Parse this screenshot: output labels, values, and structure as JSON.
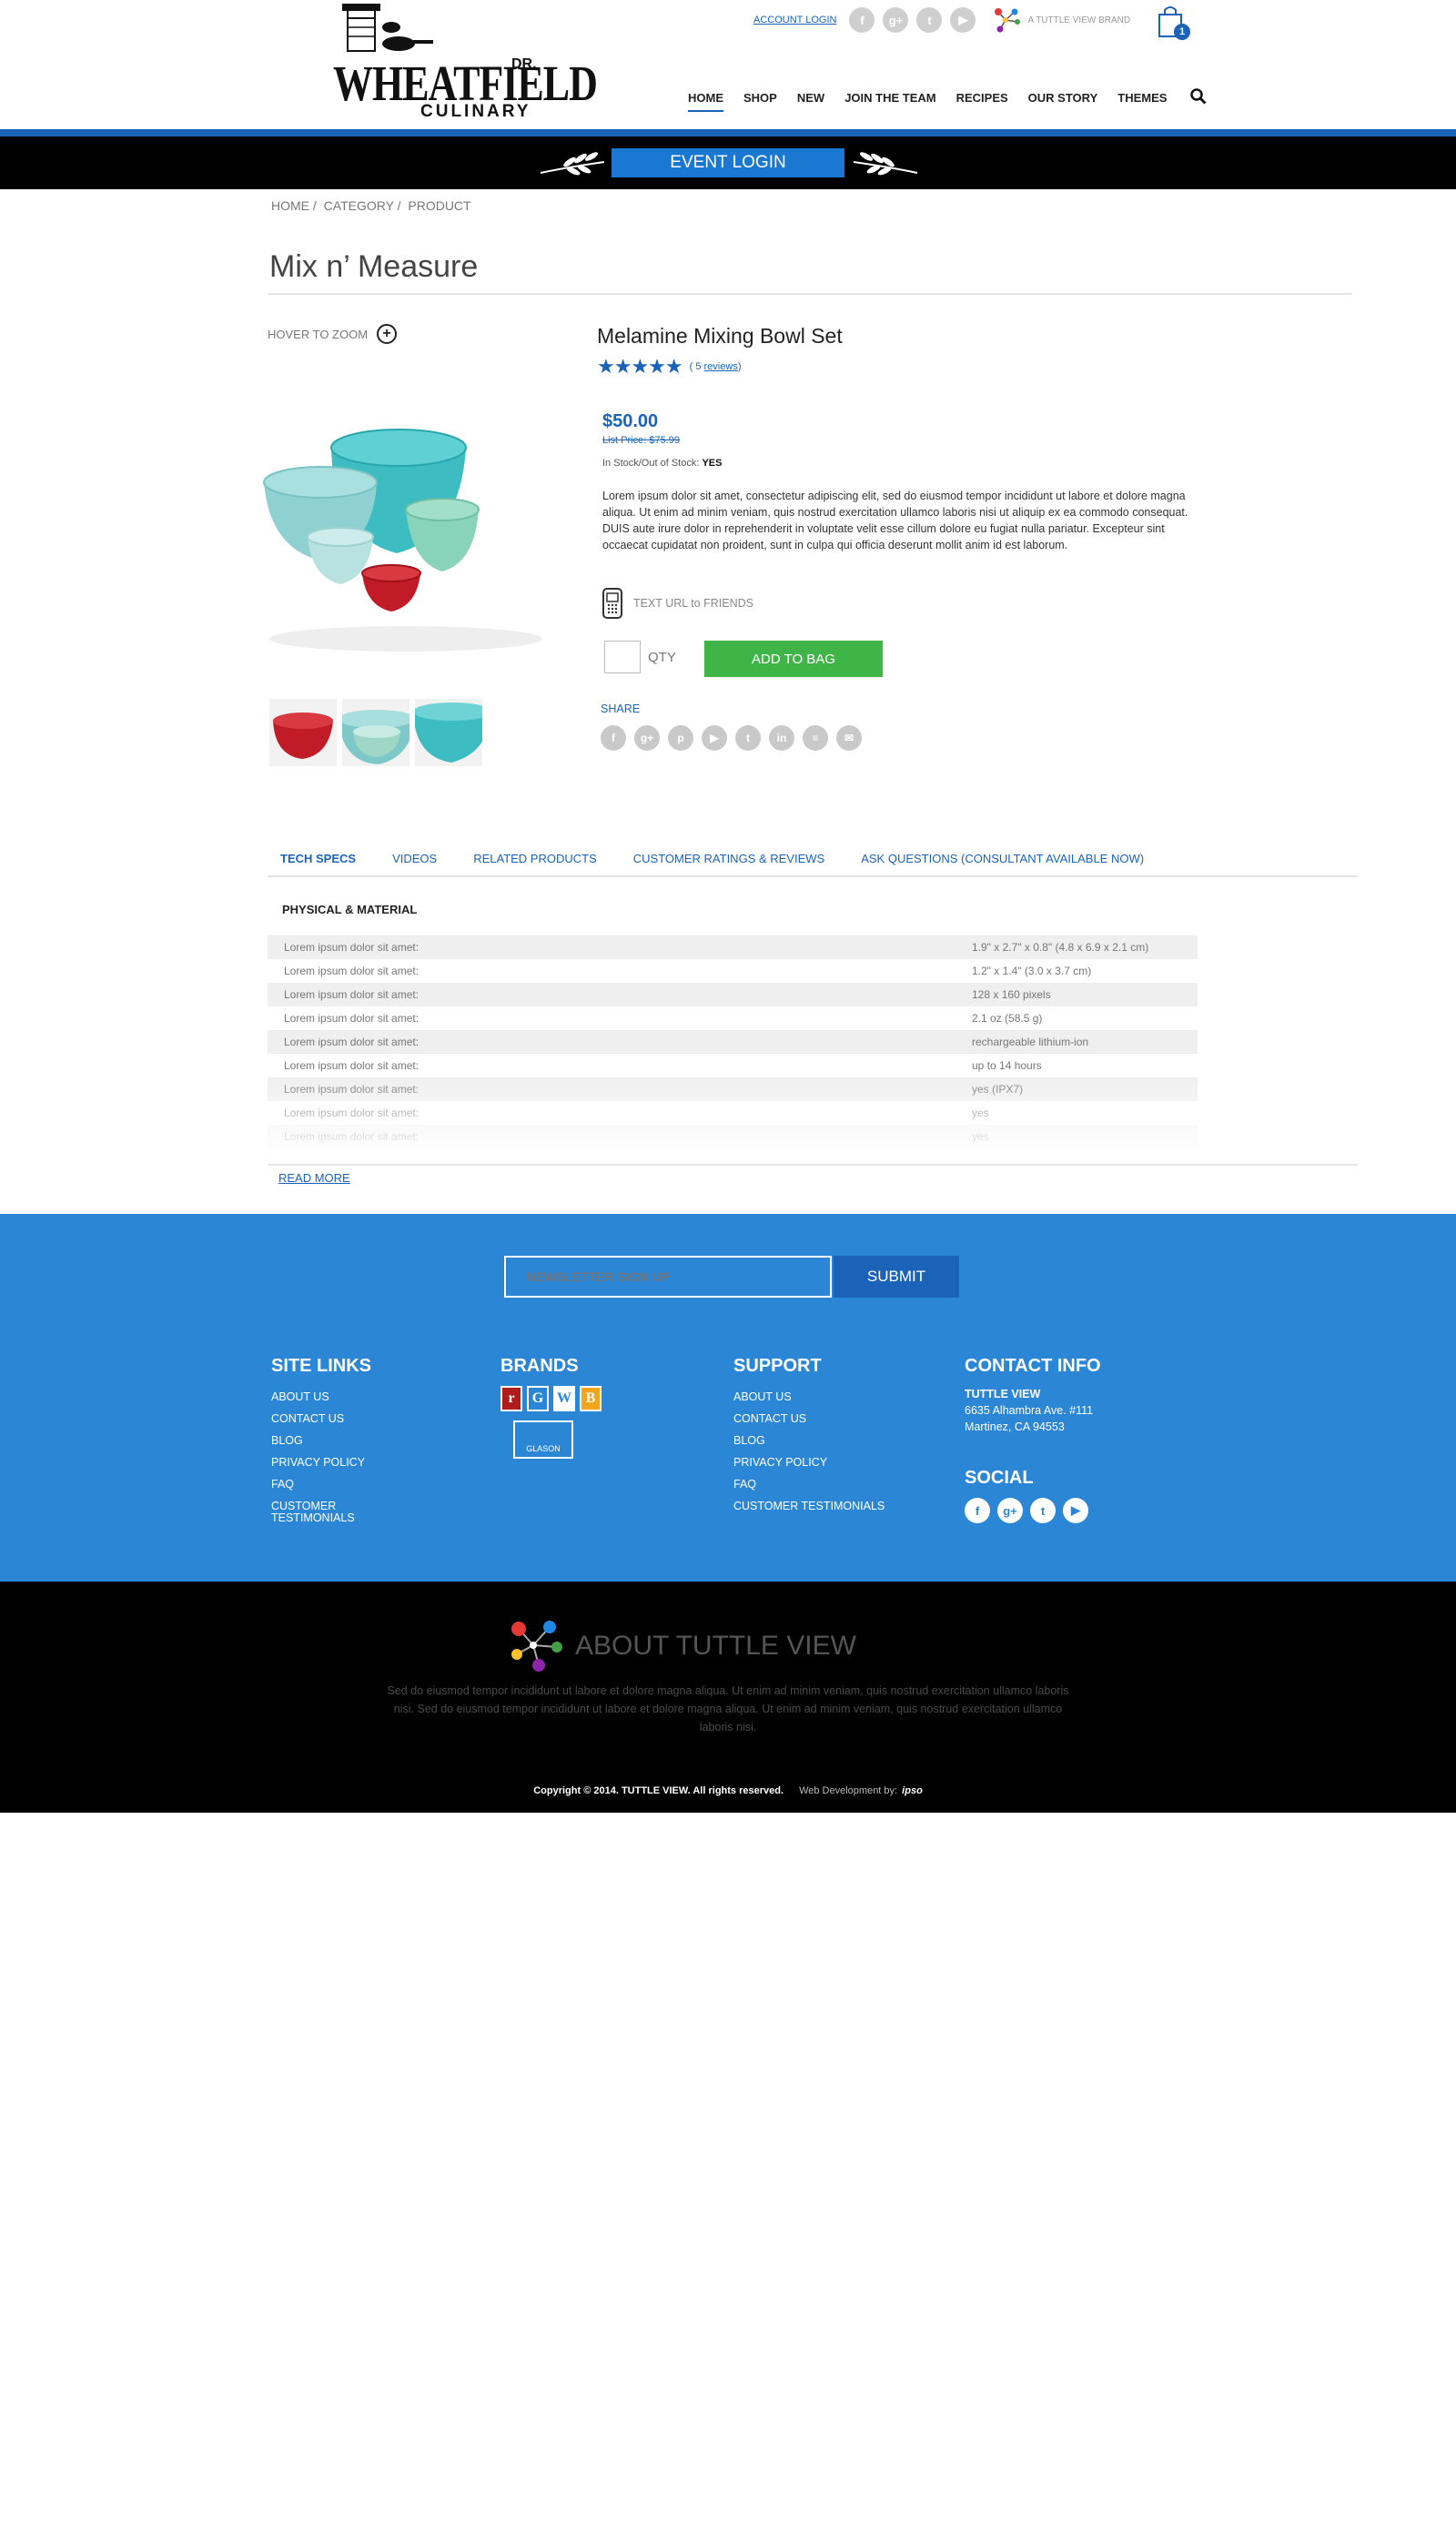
{
  "header": {
    "logo_word1": "WHEATFIELD",
    "logo_dr": "DR.",
    "logo_word2": "CULINARY",
    "account_login": "ACCOUNT LOGIN",
    "social_icons": [
      "facebook-icon",
      "google-plus-icon",
      "twitter-icon",
      "youtube-icon"
    ],
    "social_glyphs": [
      "f",
      "g+",
      "t",
      "▶"
    ],
    "tv_brand": "A TUTTLE VIEW BRAND",
    "cart_count": "1",
    "nav": [
      "HOME",
      "SHOP",
      "NEW",
      "JOIN THE TEAM",
      "RECIPES",
      "OUR STORY",
      "THEMES"
    ],
    "active_nav": "HOME",
    "event_login": "EVENT LOGIN"
  },
  "breadcrumb": [
    "HOME",
    "/",
    "CATEGORY",
    "/",
    "PRODUCT"
  ],
  "page_title": "Mix n’ Measure",
  "gallery": {
    "zoom_hint": "HOVER TO ZOOM",
    "zoom_glyph": "+"
  },
  "product": {
    "name": "Melamine Mixing Bowl Set",
    "stars": "★★★★★",
    "rating": 5,
    "reviews_prefix": "( 5 ",
    "reviews_link": "reviews",
    "reviews_suffix": ")",
    "price": "$50.00",
    "list_price": "List Price: $75.99",
    "stock_label": "In Stock/Out of Stock:",
    "stock_value": "YES",
    "description": "Lorem ipsum dolor sit amet, consectetur adipiscing elit, sed do eiusmod tempor incididunt ut labore et dolore magna aliqua. Ut enim ad minim veniam, quis nostrud exercitation ullamco laboris nisi ut aliquip ex ea commodo consequat. DUIS aute irure dolor in reprehenderit in voluptate velit esse cillum dolore eu fugiat nulla pariatur. Excepteur sint occaecat cupidatat non proident, sunt in culpa qui officia deserunt mollit anim id est laborum.",
    "text_url": "TEXT URL to FRIENDS",
    "qty_label": "QTY",
    "add_to_bag": "ADD TO BAG",
    "share_label": "SHARE",
    "share_icons": [
      "facebook-icon",
      "google-plus-icon",
      "pinterest-icon",
      "youtube-icon",
      "twitter-icon",
      "linkedin-icon",
      "clipboard-icon",
      "email-icon"
    ],
    "share_glyphs": [
      "f",
      "g+",
      "p",
      "▶",
      "t",
      "in",
      "≡",
      "✉"
    ]
  },
  "tabs": [
    "TECH SPECS",
    "VIDEOS",
    "RELATED PRODUCTS",
    "CUSTOMER RATINGS & REVIEWS",
    "ASK QUESTIONS (CONSULTANT AVAILABLE NOW)"
  ],
  "active_tab": "TECH SPECS",
  "specs": {
    "heading": "PHYSICAL & MATERIAL",
    "rows": [
      {
        "key": "Lorem ipsum dolor sit amet:",
        "value": "1.9\" x 2.7\" x 0.8\" (4.8 x 6.9 x 2.1 cm)"
      },
      {
        "key": "Lorem ipsum dolor sit amet:",
        "value": "1.2\" x 1.4\" (3.0 x 3.7 cm)"
      },
      {
        "key": "Lorem ipsum dolor sit amet:",
        "value": "128 x 160 pixels"
      },
      {
        "key": "Lorem ipsum dolor sit amet:",
        "value": "2.1 oz (58.5 g)"
      },
      {
        "key": "Lorem ipsum dolor sit amet:",
        "value": "rechargeable lithium-ion"
      },
      {
        "key": "Lorem ipsum dolor sit amet:",
        "value": "up to 14 hours"
      },
      {
        "key": "Lorem ipsum dolor sit amet:",
        "value": "yes (IPX7)"
      },
      {
        "key": "Lorem ipsum dolor sit amet:",
        "value": "yes"
      },
      {
        "key": "Lorem ipsum dolor sit amet:",
        "value": "yes"
      }
    ],
    "read_more": "READ MORE"
  },
  "footer": {
    "newsletter_placeholder": "NEWSLETTER SIGN UP",
    "submit": "SUBMIT",
    "site_links_title": "SITE LINKS",
    "site_links": [
      "ABOUT US",
      "CONTACT US",
      "BLOG",
      "PRIVACY POLICY",
      "FAQ",
      "CUSTOMER TESTIMONIALS"
    ],
    "brands_title": "BRANDS",
    "brand_tiles": [
      {
        "letter": "r",
        "bg": "#b01b1b",
        "fg": "#ffffff"
      },
      {
        "letter": "G",
        "bg": "#2b86d6",
        "fg": "#ffffff"
      },
      {
        "letter": "W",
        "bg": "#ffffff",
        "fg": "#2b86d6"
      },
      {
        "letter": "B",
        "bg": "#f2a51c",
        "fg": "#ffffff"
      }
    ],
    "glason": "GLASON",
    "support_title": "SUPPORT",
    "support_links": [
      "ABOUT US",
      "CONTACT US",
      "BLOG",
      "PRIVACY POLICY",
      "FAQ",
      "CUSTOMER TESTIMONIALS"
    ],
    "contact_title": "CONTACT INFO",
    "contact_name": "TUTTLE VIEW",
    "contact_addr1": "6635 Alhambra Ave. #111",
    "contact_addr2": "Martinez, CA 94553",
    "social_title": "SOCIAL",
    "social_icons": [
      "facebook-icon",
      "google-plus-icon",
      "twitter-icon",
      "youtube-icon"
    ],
    "social_glyphs": [
      "f",
      "g+",
      "t",
      "▶"
    ]
  },
  "about": {
    "title": "ABOUT TUTTLE VIEW",
    "text": "Sed do eiusmod tempor incididunt ut labore et dolore magna aliqua. Ut enim ad minim veniam, quis nostrud exercitation ullamco laboris nisi. Sed do eiusmod tempor incididunt ut labore et dolore magna aliqua. Ut enim ad minim veniam, quis nostrud exercitation ullamco laboris nisi.",
    "copyright": "Copyright © 2014. TUTTLE VIEW. All rights reserved.",
    "web_dev": "Web Development by:",
    "dev_name": "ipso"
  },
  "colors": {
    "brand_blue": "#1a63b8",
    "footer_blue": "#2b86d6",
    "add_to_bag_green": "#3fb548",
    "event_bar": "#000000"
  }
}
